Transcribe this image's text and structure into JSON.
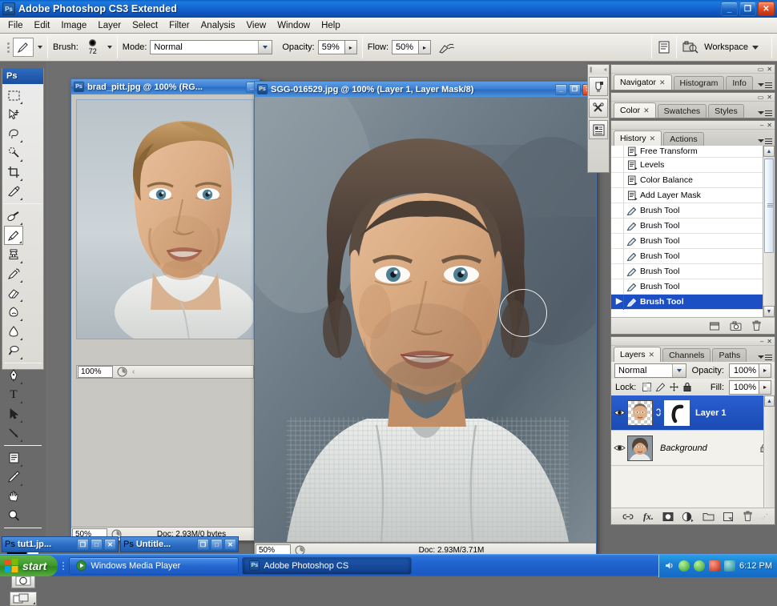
{
  "window": {
    "title": "Adobe Photoshop CS3 Extended",
    "app_icon": "Ps",
    "minimize_label": "_",
    "restore_label": "❐",
    "close_label": "✕"
  },
  "menubar": {
    "items": [
      "File",
      "Edit",
      "Image",
      "Layer",
      "Select",
      "Filter",
      "Analysis",
      "View",
      "Window",
      "Help"
    ]
  },
  "options_bar": {
    "tool_icon": "brush-tool-icon",
    "brush_label": "Brush:",
    "brush_size": "72",
    "mode_label": "Mode:",
    "mode_value": "Normal",
    "opacity_label": "Opacity:",
    "opacity_value": "59%",
    "flow_label": "Flow:",
    "flow_value": "50%",
    "airbrush_icon": "airbrush-icon",
    "palettes_button_icon": "palette-toggle-icon",
    "bridge_icon": "go-to-bridge-icon",
    "workspace_label": "Workspace"
  },
  "toolbox": {
    "header": "Ps",
    "tools": [
      {
        "name": "marquee-tool",
        "has_menu": true
      },
      {
        "name": "move-tool",
        "has_menu": false
      },
      {
        "name": "lasso-tool",
        "has_menu": true
      },
      {
        "name": "magic-wand-tool",
        "has_menu": true
      },
      {
        "name": "crop-tool",
        "has_menu": true
      },
      {
        "name": "slice-tool",
        "has_menu": true
      },
      {
        "name": "healing-brush-tool",
        "has_menu": true
      },
      {
        "name": "brush-tool",
        "has_menu": true,
        "selected": true
      },
      {
        "name": "clone-stamp-tool",
        "has_menu": true
      },
      {
        "name": "history-brush-tool",
        "has_menu": true
      },
      {
        "name": "eraser-tool",
        "has_menu": true
      },
      {
        "name": "gradient-tool",
        "has_menu": true
      },
      {
        "name": "blur-tool",
        "has_menu": true
      },
      {
        "name": "dodge-tool",
        "has_menu": true
      },
      {
        "name": "pen-tool",
        "has_menu": true
      },
      {
        "name": "type-tool",
        "has_menu": true
      },
      {
        "name": "path-selection-tool",
        "has_menu": true
      },
      {
        "name": "line-shape-tool",
        "has_menu": true
      },
      {
        "name": "notes-tool",
        "has_menu": true
      },
      {
        "name": "eyedropper-tool",
        "has_menu": true
      },
      {
        "name": "hand-tool",
        "has_menu": false
      },
      {
        "name": "zoom-tool",
        "has_menu": false
      }
    ],
    "foreground_color": "#000000",
    "background_color": "#ffffff",
    "quick_mask_icon": "quick-mask-icon",
    "screen_mode_icon": "screen-mode-icon"
  },
  "icon_dock": {
    "items": [
      "brushes-icon",
      "tool-presets-icon",
      "layer-comps-icon"
    ]
  },
  "documents": [
    {
      "title": "brad_pitt.jpg @ 100% (RG...",
      "zoom": "50%",
      "inner_zoom": "100%",
      "doc_info": "Doc: 2.93M/0 bytes",
      "inner_doc_info": "",
      "buttons": [
        "_"
      ]
    },
    {
      "title": "SGG-016529.jpg @ 100% (Layer 1, Layer Mask/8)",
      "zoom": "50%",
      "doc_info": "Doc: 2.93M/3.71M",
      "buttons": [
        "_",
        "❐",
        "✕"
      ]
    }
  ],
  "palettes": {
    "group1": {
      "tabs": [
        {
          "label": "Navigator",
          "active": true,
          "closable": true
        },
        {
          "label": "Histogram",
          "active": false,
          "closable": false
        },
        {
          "label": "Info",
          "active": false,
          "closable": false
        }
      ],
      "collapse_icon": "collapse-icon",
      "close_icon": "close-icon"
    },
    "group2": {
      "tabs": [
        {
          "label": "Color",
          "active": true,
          "closable": true
        },
        {
          "label": "Swatches",
          "active": false,
          "closable": false
        },
        {
          "label": "Styles",
          "active": false,
          "closable": false
        }
      ],
      "collapse_icon": "collapse-icon",
      "close_icon": "close-icon"
    },
    "history": {
      "tabs": [
        {
          "label": "History",
          "active": true,
          "closable": true
        },
        {
          "label": "Actions",
          "active": false,
          "closable": false
        }
      ],
      "items": [
        {
          "label": "Free Transform",
          "icon": "snapshot-state-icon",
          "selected": false
        },
        {
          "label": "Levels",
          "icon": "snapshot-state-icon",
          "selected": false
        },
        {
          "label": "Color Balance",
          "icon": "snapshot-state-icon",
          "selected": false
        },
        {
          "label": "Add Layer Mask",
          "icon": "snapshot-state-icon",
          "selected": false
        },
        {
          "label": "Brush Tool",
          "icon": "brush-state-icon",
          "selected": false
        },
        {
          "label": "Brush Tool",
          "icon": "brush-state-icon",
          "selected": false
        },
        {
          "label": "Brush Tool",
          "icon": "brush-state-icon",
          "selected": false
        },
        {
          "label": "Brush Tool",
          "icon": "brush-state-icon",
          "selected": false
        },
        {
          "label": "Brush Tool",
          "icon": "brush-state-icon",
          "selected": false
        },
        {
          "label": "Brush Tool",
          "icon": "brush-state-icon",
          "selected": false
        },
        {
          "label": "Brush Tool",
          "icon": "brush-state-icon",
          "selected": true
        }
      ],
      "footer_buttons": [
        "new-document-from-state-icon",
        "new-snapshot-icon",
        "delete-state-icon"
      ]
    },
    "layers": {
      "tabs": [
        {
          "label": "Layers",
          "active": true,
          "closable": true
        },
        {
          "label": "Channels",
          "active": false,
          "closable": false
        },
        {
          "label": "Paths",
          "active": false,
          "closable": false
        }
      ],
      "blend_mode": "Normal",
      "opacity_label": "Opacity:",
      "opacity_value": "100%",
      "lock_label": "Lock:",
      "lock_icons": [
        "lock-transparent-pixels-icon",
        "lock-image-pixels-icon",
        "lock-position-icon",
        "lock-all-icon"
      ],
      "fill_label": "Fill:",
      "fill_value": "100%",
      "items": [
        {
          "name": "Layer 1",
          "active": true,
          "has_mask": true,
          "locked": false,
          "visible": true,
          "italic": false
        },
        {
          "name": "Background",
          "active": false,
          "has_mask": false,
          "locked": true,
          "visible": true,
          "italic": true
        }
      ],
      "footer_buttons": [
        "link-layers-icon",
        "layer-style-icon",
        "layer-mask-icon",
        "adjustment-layer-icon",
        "new-group-icon",
        "new-layer-icon",
        "delete-layer-icon"
      ]
    }
  },
  "minimized_windows": [
    {
      "title": "tut1.jp...",
      "buttons": [
        "❐",
        "□",
        "✕"
      ]
    },
    {
      "title": "Untitle...",
      "buttons": [
        "❐",
        "□",
        "✕"
      ]
    }
  ],
  "taskbar": {
    "start_label": "start",
    "buttons": [
      {
        "label": "Windows Media Player",
        "icon": "media-player-icon"
      },
      {
        "label": "Adobe Photoshop CS",
        "icon": "photoshop-icon"
      }
    ],
    "clock": "6:12 PM",
    "tray_icons": [
      "volume-icon",
      "shield-green-icon",
      "shield-green-icon",
      "app-red-icon",
      "app-teal-icon"
    ]
  },
  "colors": {
    "title_blue": "#1464cf",
    "selection_blue": "#1d4fc4",
    "panel_gray": "#e8e6e0",
    "canvas_gray": "#6f6f6f"
  }
}
